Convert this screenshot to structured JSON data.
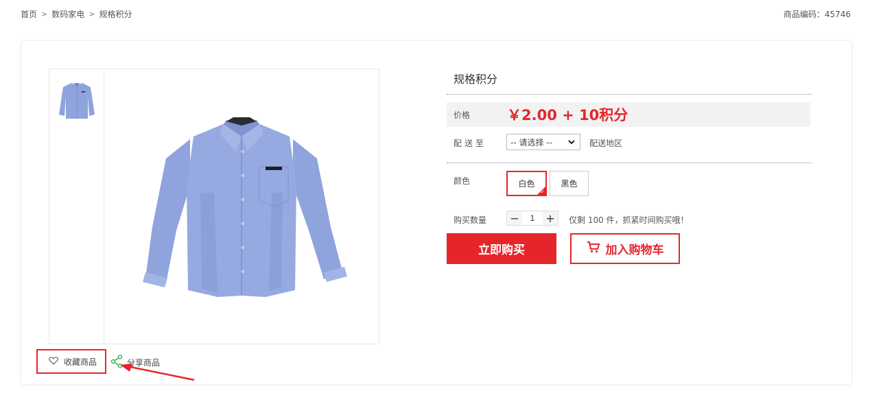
{
  "breadcrumb": {
    "items": [
      "首页",
      "数码家电",
      "规格积分"
    ],
    "separator": ">"
  },
  "sku": {
    "label": "商品编码：45746"
  },
  "product": {
    "title": "规格积分",
    "price_label": "价格",
    "price_value": "￥2.00 + 10积分",
    "shipping_label": "配送至",
    "shipping_select": "-- 请选择 --",
    "shipping_area": "配送地区",
    "color_label": "颜色",
    "colors": [
      "白色",
      "黑色"
    ],
    "selected_color": "白色",
    "qty_label": "购买数量",
    "qty_value": "1",
    "stock_text": "仅剩 100 件，抓紧时间购买哦！",
    "buy_now": "立即购买",
    "add_cart": "加入购物车"
  },
  "actions": {
    "favorite": "收藏商品",
    "share": "分享商品"
  },
  "colors": {
    "accent": "#e4262b",
    "shirt": "#8fa3dc"
  },
  "icons": [
    "heart-icon",
    "share-icon",
    "cart-icon",
    "chevron-down-icon",
    "checkmark-icon",
    "arrow-icon"
  ]
}
